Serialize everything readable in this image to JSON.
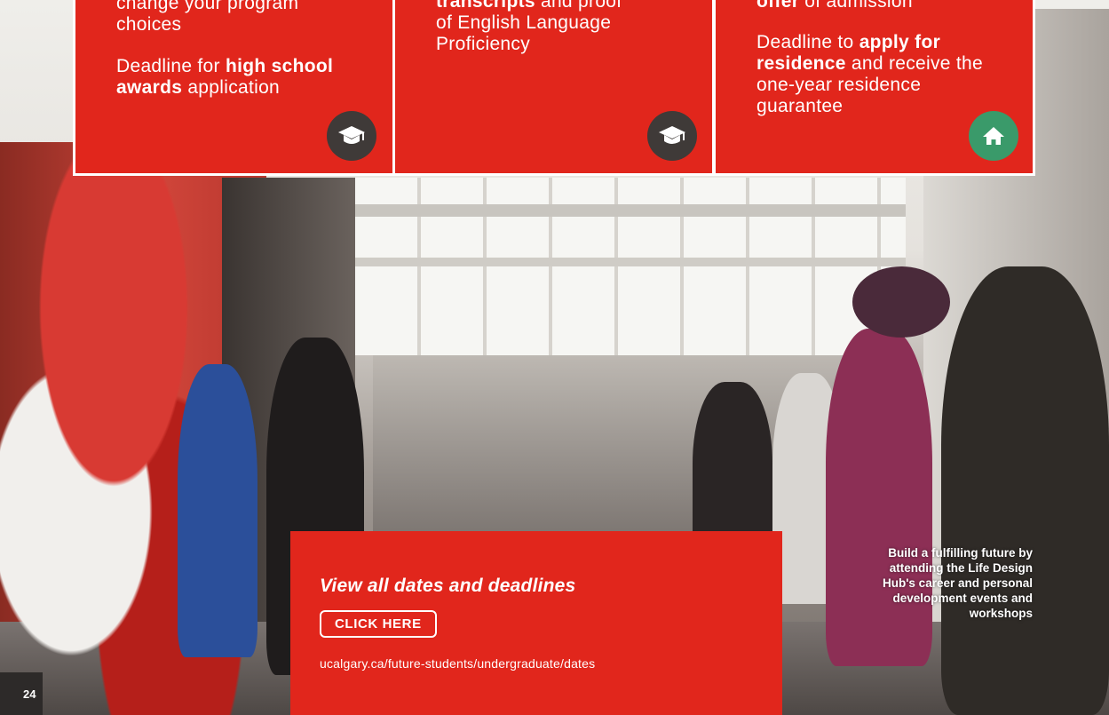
{
  "cards": [
    {
      "para1": [
        {
          "t": "change your program",
          "b": false
        },
        {
          "t": "choices",
          "b": false
        }
      ],
      "para2_pre": "Deadline for ",
      "para2_bold": "high school awards",
      "para2_post": " application",
      "icon": "graduation-cap-icon"
    },
    {
      "line1_bold": "transcripts",
      "line1_post": " and proof",
      "line2": "of English Language",
      "line3": "Proficiency",
      "icon": "graduation-cap-icon"
    },
    {
      "line1_bold": "offer",
      "line1_post": " of admission",
      "para2_pre": "Deadline to ",
      "para2_bold": "apply for residence",
      "para2_post": " and receive the one-year residence guarantee",
      "icon": "home-icon"
    }
  ],
  "promo": {
    "headline": "View all dates and deadlines",
    "button_label": "CLICK HERE",
    "url": "ucalgary.ca/future-students/undergraduate/dates"
  },
  "caption": "Build a fulfilling future by attending the Life Design Hub's career and personal development events and workshops",
  "page_number": "24",
  "colors": {
    "brand_red": "#e1261c",
    "icon_dark": "#3f3a38",
    "icon_green": "#3a9a6a"
  }
}
